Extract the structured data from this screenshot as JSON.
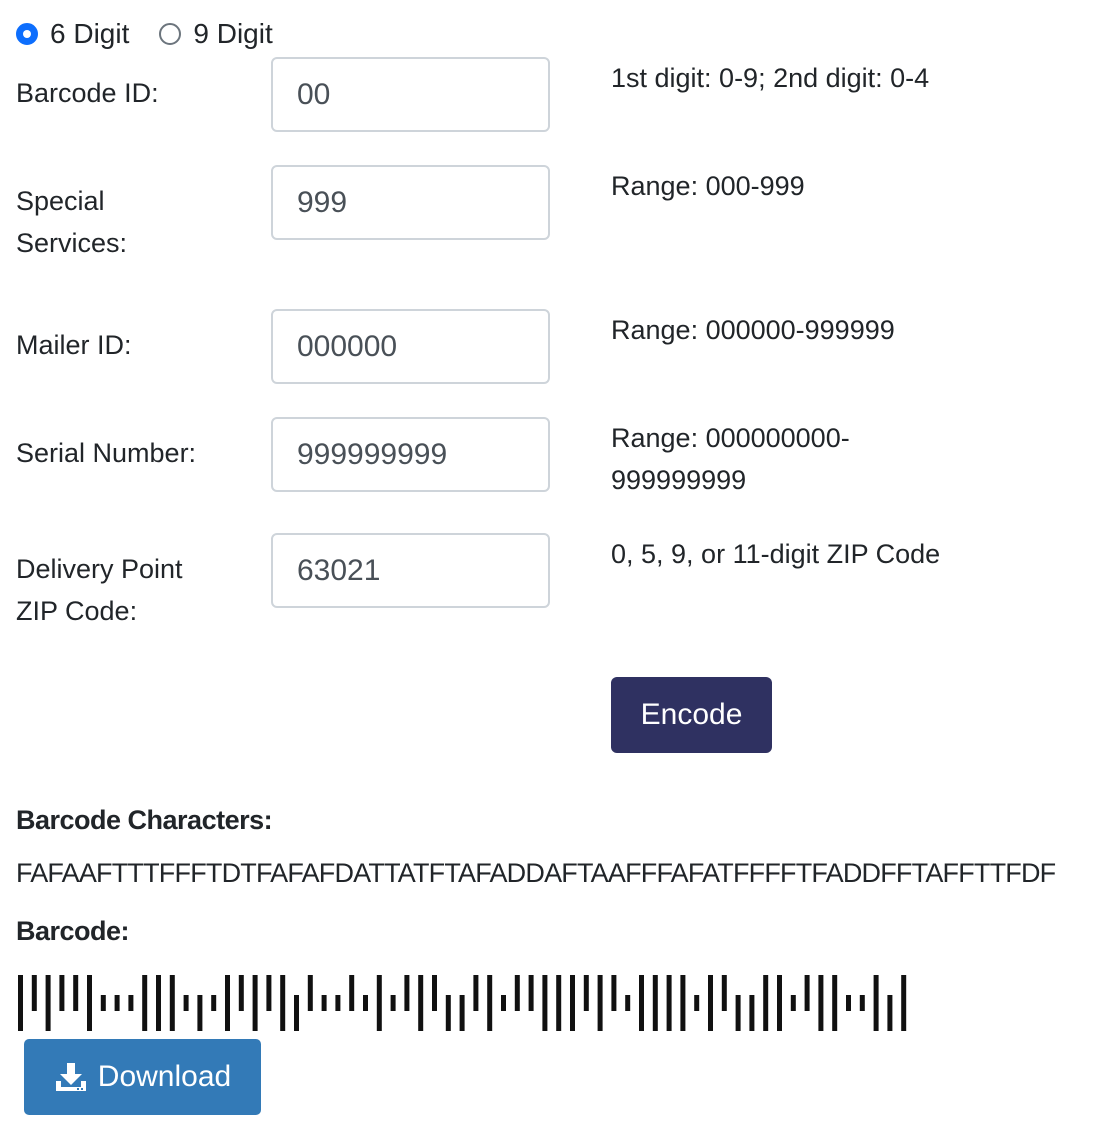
{
  "options": {
    "six_digit": {
      "label": "6 Digit",
      "checked": true
    },
    "nine_digit": {
      "label": "9 Digit",
      "checked": false
    }
  },
  "fields": {
    "barcode_id": {
      "label": "Barcode ID:",
      "value": "00",
      "hint": "1st digit: 0-9; 2nd digit: 0-4"
    },
    "special_services": {
      "label": "Special Services:",
      "value": "999",
      "hint": "Range: 000-999"
    },
    "mailer_id": {
      "label": "Mailer ID:",
      "value": "000000",
      "hint": "Range: 000000-999999"
    },
    "serial_number": {
      "label": "Serial Number:",
      "value": "999999999",
      "hint": "Range: 000000000-999999999"
    },
    "zip": {
      "label": "Delivery Point ZIP Code:",
      "value": "63021",
      "hint": "0, 5, 9, or 11-digit ZIP Code"
    }
  },
  "encode_label": "Encode",
  "result": {
    "characters_heading": "Barcode Characters:",
    "characters": "FAFAAFTTTFFFTDTFAFAFDATTATFTAFADDAFTAAFFFAFATFFFFTFADDFFTAFFTTFDF",
    "barcode_heading": "Barcode:"
  },
  "download_label": "Download",
  "colors": {
    "encode_bg": "#2f3161",
    "download_bg": "#337ab7",
    "radio_accent": "#0d6efd"
  },
  "icons": {
    "download": "download-icon"
  }
}
